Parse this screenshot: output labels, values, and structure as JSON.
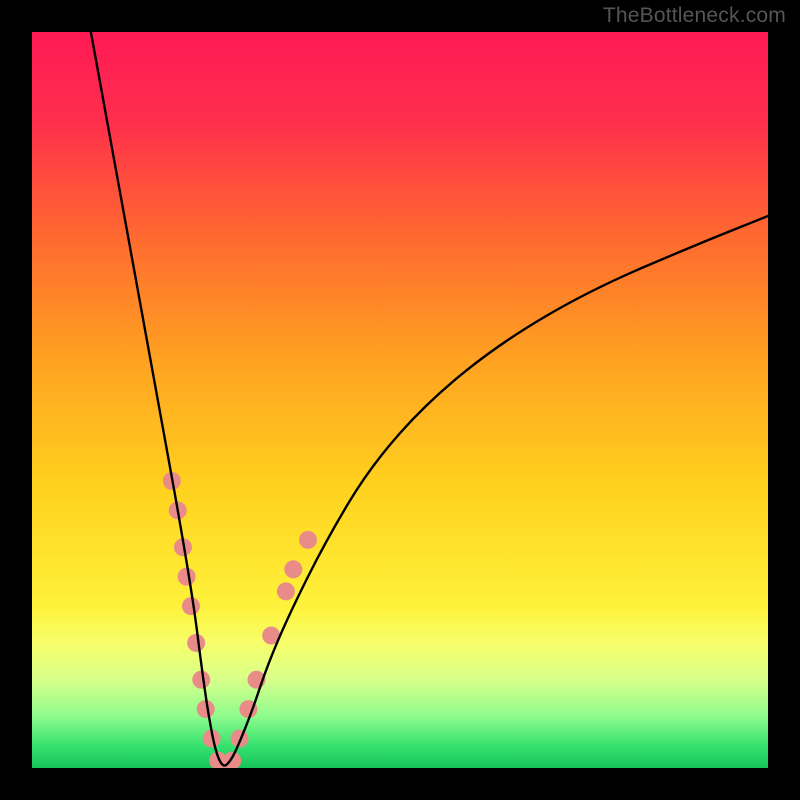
{
  "watermark": "TheBottleneck.com",
  "chart_data": {
    "type": "line",
    "title": "",
    "xlabel": "",
    "ylabel": "",
    "xlim": [
      0,
      100
    ],
    "ylim": [
      0,
      100
    ],
    "gradient_stops": [
      {
        "offset": 0.0,
        "color": "#ff1a55"
      },
      {
        "offset": 0.12,
        "color": "#ff2e4d"
      },
      {
        "offset": 0.28,
        "color": "#ff6a2f"
      },
      {
        "offset": 0.45,
        "color": "#ffa321"
      },
      {
        "offset": 0.62,
        "color": "#ffd21e"
      },
      {
        "offset": 0.78,
        "color": "#fff23a"
      },
      {
        "offset": 0.83,
        "color": "#f7ff6a"
      },
      {
        "offset": 0.88,
        "color": "#d8ff8a"
      },
      {
        "offset": 0.93,
        "color": "#8dfc8d"
      },
      {
        "offset": 0.97,
        "color": "#36e26e"
      },
      {
        "offset": 1.0,
        "color": "#17c45b"
      }
    ],
    "series": [
      {
        "name": "bottleneck-curve",
        "x": [
          8,
          10,
          12,
          14,
          16,
          18,
          20,
          22,
          23,
          24,
          25,
          26,
          27,
          28,
          30,
          32,
          35,
          40,
          46,
          54,
          64,
          76,
          90,
          100
        ],
        "y": [
          100,
          89,
          78,
          67,
          56,
          45,
          34,
          22,
          14,
          7,
          2,
          0,
          1,
          3,
          8,
          14,
          21,
          31,
          41,
          50,
          58,
          65,
          71,
          75
        ]
      }
    ],
    "markers": {
      "name": "highlight-dots",
      "color": "#e98b88",
      "radius_px": 9,
      "points": [
        {
          "x": 19.0,
          "y": 39
        },
        {
          "x": 19.8,
          "y": 35
        },
        {
          "x": 20.5,
          "y": 30
        },
        {
          "x": 21.0,
          "y": 26
        },
        {
          "x": 21.6,
          "y": 22
        },
        {
          "x": 22.3,
          "y": 17
        },
        {
          "x": 23.0,
          "y": 12
        },
        {
          "x": 23.6,
          "y": 8
        },
        {
          "x": 24.4,
          "y": 4
        },
        {
          "x": 25.3,
          "y": 1
        },
        {
          "x": 26.2,
          "y": 0
        },
        {
          "x": 27.2,
          "y": 1
        },
        {
          "x": 28.2,
          "y": 4
        },
        {
          "x": 29.4,
          "y": 8
        },
        {
          "x": 30.5,
          "y": 12
        },
        {
          "x": 32.5,
          "y": 18
        },
        {
          "x": 34.5,
          "y": 24
        },
        {
          "x": 35.5,
          "y": 27
        },
        {
          "x": 37.5,
          "y": 31
        }
      ]
    },
    "green_band": {
      "y_from": 0,
      "y_to": 3
    }
  }
}
